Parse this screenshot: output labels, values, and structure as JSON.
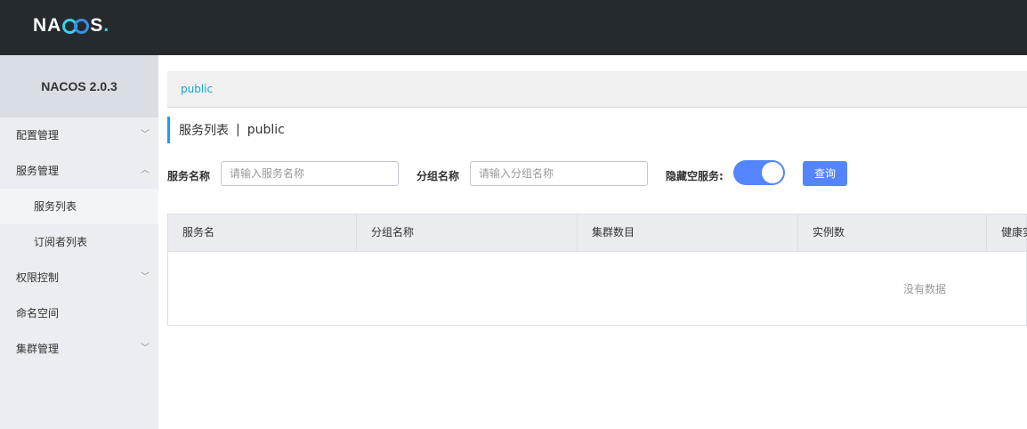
{
  "header": {
    "logo_text_left": "NA",
    "logo_text_right": "S",
    "logo_dot": "."
  },
  "sidebar": {
    "title": "NACOS 2.0.3",
    "items": [
      {
        "label": "配置管理",
        "chevron": "﹀"
      },
      {
        "label": "服务管理",
        "chevron": "︿"
      },
      {
        "label": "服务列表"
      },
      {
        "label": "订阅者列表"
      },
      {
        "label": "权限控制",
        "chevron": "﹀"
      },
      {
        "label": "命名空间"
      },
      {
        "label": "集群管理",
        "chevron": "﹀"
      }
    ]
  },
  "main": {
    "namespace_crumb": "public",
    "page_title": "服务列表",
    "title_separator": "|",
    "title_namespace": "public",
    "filters": {
      "service_name_label": "服务名称",
      "service_name_placeholder": "请输入服务名称",
      "group_name_label": "分组名称",
      "group_name_placeholder": "请输入分组名称",
      "hide_empty_label": "隐藏空服务:",
      "hide_empty_on": true,
      "query_label": "查询"
    },
    "table": {
      "columns": [
        "服务名",
        "分组名称",
        "集群数目",
        "实例数",
        "健康实例数"
      ],
      "empty_text": "没有数据"
    }
  },
  "colors": {
    "topbar": "#252a2f",
    "accent": "#5584ff",
    "link": "#19a4d8"
  }
}
